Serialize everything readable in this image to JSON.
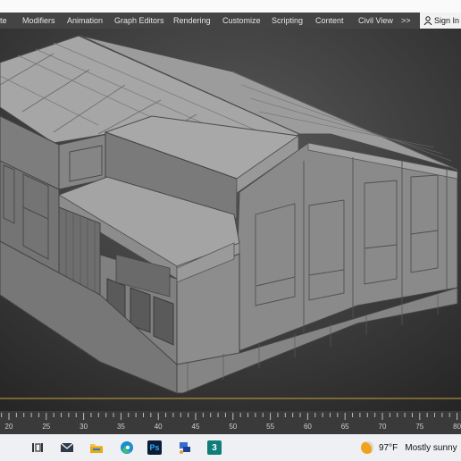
{
  "menubar": {
    "items": [
      "te",
      "Modifiers",
      "Animation",
      "Graph Editors",
      "Rendering",
      "Customize",
      "Scripting",
      "Content",
      "Civil View"
    ],
    "more_label": ">>",
    "sign_in": "Sign In"
  },
  "timeline": {
    "ticks": [
      "20",
      "25",
      "30",
      "35",
      "40",
      "45",
      "50",
      "55",
      "60",
      "65",
      "70",
      "75",
      "80"
    ]
  },
  "taskbar": {
    "apps": [
      "task-view-icon",
      "mail-icon",
      "file-explorer-icon",
      "edge-icon",
      "photoshop-icon",
      "network-icon",
      "3ds-max-icon"
    ],
    "photoshop_label": "Ps",
    "max_label": "3",
    "temperature": "97°F",
    "condition": "Mostly sunny"
  },
  "colors": {
    "viewport_bg": "#2a2a2a",
    "menu_bg": "#444444",
    "ground_line": "#c8a23a",
    "model": "#8e8e8e"
  }
}
